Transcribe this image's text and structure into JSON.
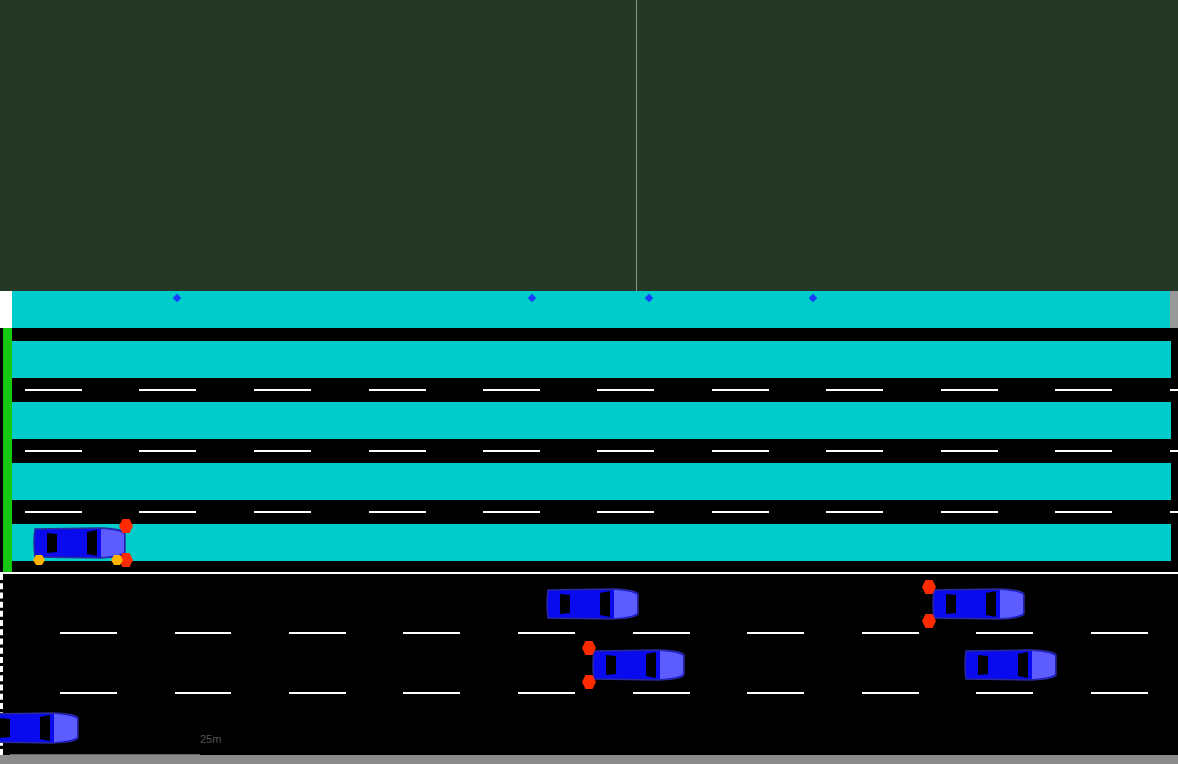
{
  "scene": {
    "scale_label": "25m"
  },
  "upper_lanes": [
    {
      "highlighted": true
    },
    {
      "highlighted": true
    },
    {
      "highlighted": true
    },
    {
      "highlighted": true
    }
  ],
  "vehicles": [
    {
      "brake_lights": true,
      "turn_signal": true
    },
    {
      "brake_lights": false,
      "turn_signal": false
    },
    {
      "brake_lights": true,
      "turn_signal": false
    },
    {
      "brake_lights": true,
      "turn_signal": false
    },
    {
      "brake_lights": false,
      "turn_signal": false
    },
    {
      "brake_lights": false,
      "turn_signal": false
    }
  ],
  "pedestrians": [
    {
      "visible": true
    },
    {
      "visible": true
    },
    {
      "visible": true
    },
    {
      "visible": true
    }
  ]
}
